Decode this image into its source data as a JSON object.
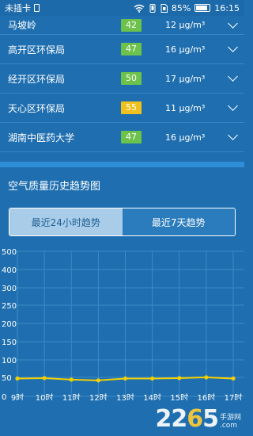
{
  "status_bar": {
    "carrier": "未插卡",
    "battery": "85%",
    "time": "16:15"
  },
  "stations": [
    {
      "name": "马坡岭",
      "aqi": "42",
      "value": "12 μg/m³",
      "color": "#6cc24a"
    },
    {
      "name": "高开区环保局",
      "aqi": "47",
      "value": "16 μg/m³",
      "color": "#6cc24a"
    },
    {
      "name": "经开区环保局",
      "aqi": "50",
      "value": "17 μg/m³",
      "color": "#6cc24a"
    },
    {
      "name": "天心区环保局",
      "aqi": "55",
      "value": "11 μg/m³",
      "color": "#f0c11d"
    },
    {
      "name": "湖南中医药大学",
      "aqi": "47",
      "value": "16 μg/m³",
      "color": "#6cc24a"
    }
  ],
  "history": {
    "title": "空气质量历史趋势图",
    "tabs": [
      {
        "label": "最近24小时趋势",
        "active": true
      },
      {
        "label": "最近7天趋势",
        "active": false
      }
    ]
  },
  "chart_data": {
    "type": "line",
    "x": [
      "9时",
      "10时",
      "11时",
      "12时",
      "13时",
      "14时",
      "15时",
      "16时",
      "17时"
    ],
    "y_ticks": [
      "500",
      "400",
      "300",
      "250",
      "200",
      "150",
      "100",
      "50",
      "0"
    ],
    "y_tick_values": [
      500,
      400,
      300,
      250,
      200,
      150,
      100,
      50,
      0
    ],
    "series": [
      {
        "values": [
          47,
          48,
          44,
          42,
          47,
          47,
          48,
          50,
          47
        ],
        "color": "#f5d000"
      }
    ],
    "grid": true,
    "line_color": "#f5d000"
  },
  "watermark": {
    "digits_a": "22",
    "digits_b": "6",
    "digits_c": "5",
    "sub_top": "手游网",
    "sub_bottom": ".com"
  }
}
